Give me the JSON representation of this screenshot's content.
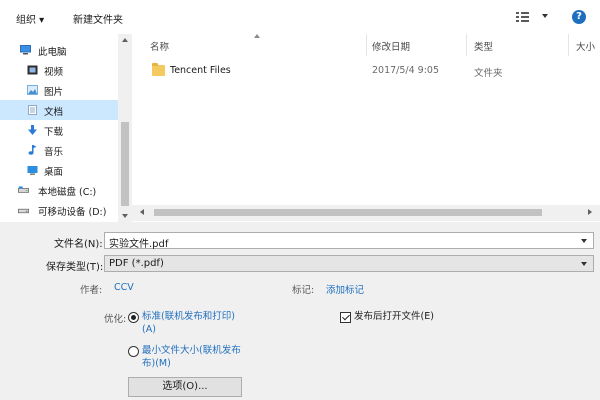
{
  "toolbar": {
    "organize_label": "组织 ▾",
    "new_folder_label": "新建文件夹",
    "view_icon": "view-options-icon",
    "help_label": "?"
  },
  "nav": {
    "items": [
      {
        "label": "此电脑",
        "icon": "computer-icon",
        "color": "#3a8ee6"
      },
      {
        "label": "视频",
        "icon": "video-icon",
        "color": "#2d2d2d"
      },
      {
        "label": "图片",
        "icon": "pictures-icon",
        "color": "#7ab0e0"
      },
      {
        "label": "文档",
        "icon": "documents-icon",
        "color": "#8fa8c4"
      },
      {
        "label": "下载",
        "icon": "download-icon",
        "color": "#2a7ad6"
      },
      {
        "label": "音乐",
        "icon": "music-icon",
        "color": "#2a7ad6"
      },
      {
        "label": "桌面",
        "icon": "desktop-icon",
        "color": "#2a8fe0"
      },
      {
        "label": "本地磁盘 (C:)",
        "icon": "drive-icon",
        "color": "#6c6c6c"
      },
      {
        "label": "可移动设备 (D:)",
        "icon": "removable-drive-icon",
        "color": "#6c6c6c"
      }
    ],
    "selected_index": 3
  },
  "list": {
    "columns": [
      "名称",
      "修改日期",
      "类型",
      "大小"
    ],
    "rows": [
      {
        "name": "Tencent Files",
        "modified": "2017/5/4 9:05",
        "type": "文件夹"
      }
    ]
  },
  "form": {
    "filename_label": "文件名(N):",
    "filename_value": "实验文件.pdf",
    "filetype_label": "保存类型(T):",
    "filetype_value": "PDF (*.pdf)",
    "author_label": "作者:",
    "author_value": "CCV",
    "tags_label": "标记:",
    "tags_value": "添加标记",
    "optimize_label": "优化:",
    "opt_standard_line1": "标准(联机发布和打印)",
    "opt_standard_line2": "(A)",
    "opt_minimum_line1": "最小文件大小(联机发布",
    "opt_minimum_line2": "布)(M)",
    "open_after_label": "发布后打开文件(E)",
    "options_button": "选项(O)..."
  }
}
